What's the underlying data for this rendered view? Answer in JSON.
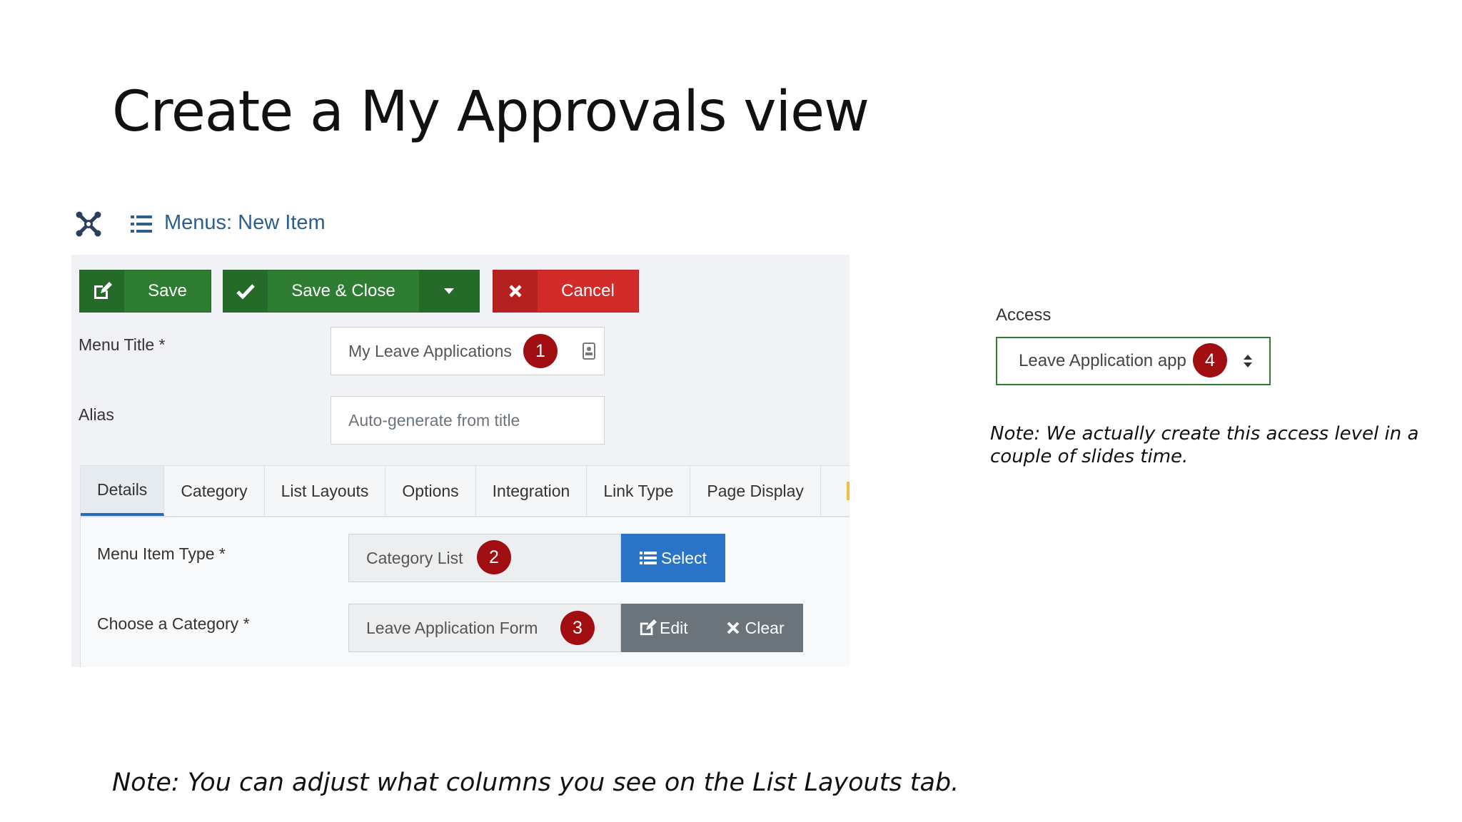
{
  "slide": {
    "title": "Create a My Approvals view",
    "note_access": "Note: We actually create this access level in a couple of slides time.",
    "note_bottom": "Note: You can adjust what columns you see on the List Layouts tab."
  },
  "header": {
    "title": "Menus: New Item",
    "logo_icon": "joomla-logo-icon",
    "page_icon": "list-icon"
  },
  "toolbar": {
    "save_label": "Save",
    "save_close_label": "Save & Close",
    "cancel_label": "Cancel"
  },
  "form": {
    "menu_title_label": "Menu Title *",
    "menu_title_value": "My Leave Applications",
    "alias_label": "Alias",
    "alias_placeholder": "Auto-generate from title"
  },
  "tabs": [
    {
      "label": "Details",
      "active": true
    },
    {
      "label": "Category",
      "active": false
    },
    {
      "label": "List Layouts",
      "active": false
    },
    {
      "label": "Options",
      "active": false
    },
    {
      "label": "Integration",
      "active": false
    },
    {
      "label": "Link Type",
      "active": false
    },
    {
      "label": "Page Display",
      "active": false
    }
  ],
  "details": {
    "menu_item_type_label": "Menu Item Type *",
    "menu_item_type_value": "Category List",
    "select_label": "Select",
    "category_label": "Choose a Category *",
    "category_value": "Leave Application Form",
    "edit_label": "Edit",
    "clear_label": "Clear"
  },
  "access": {
    "label": "Access",
    "value": "Leave Application app"
  },
  "badges": [
    "1",
    "2",
    "3",
    "4"
  ],
  "colors": {
    "green": "#2f7d32",
    "red": "#d32a2a",
    "blue": "#2a74c8",
    "badge": "#a10e12",
    "link": "#2a5f8f"
  }
}
